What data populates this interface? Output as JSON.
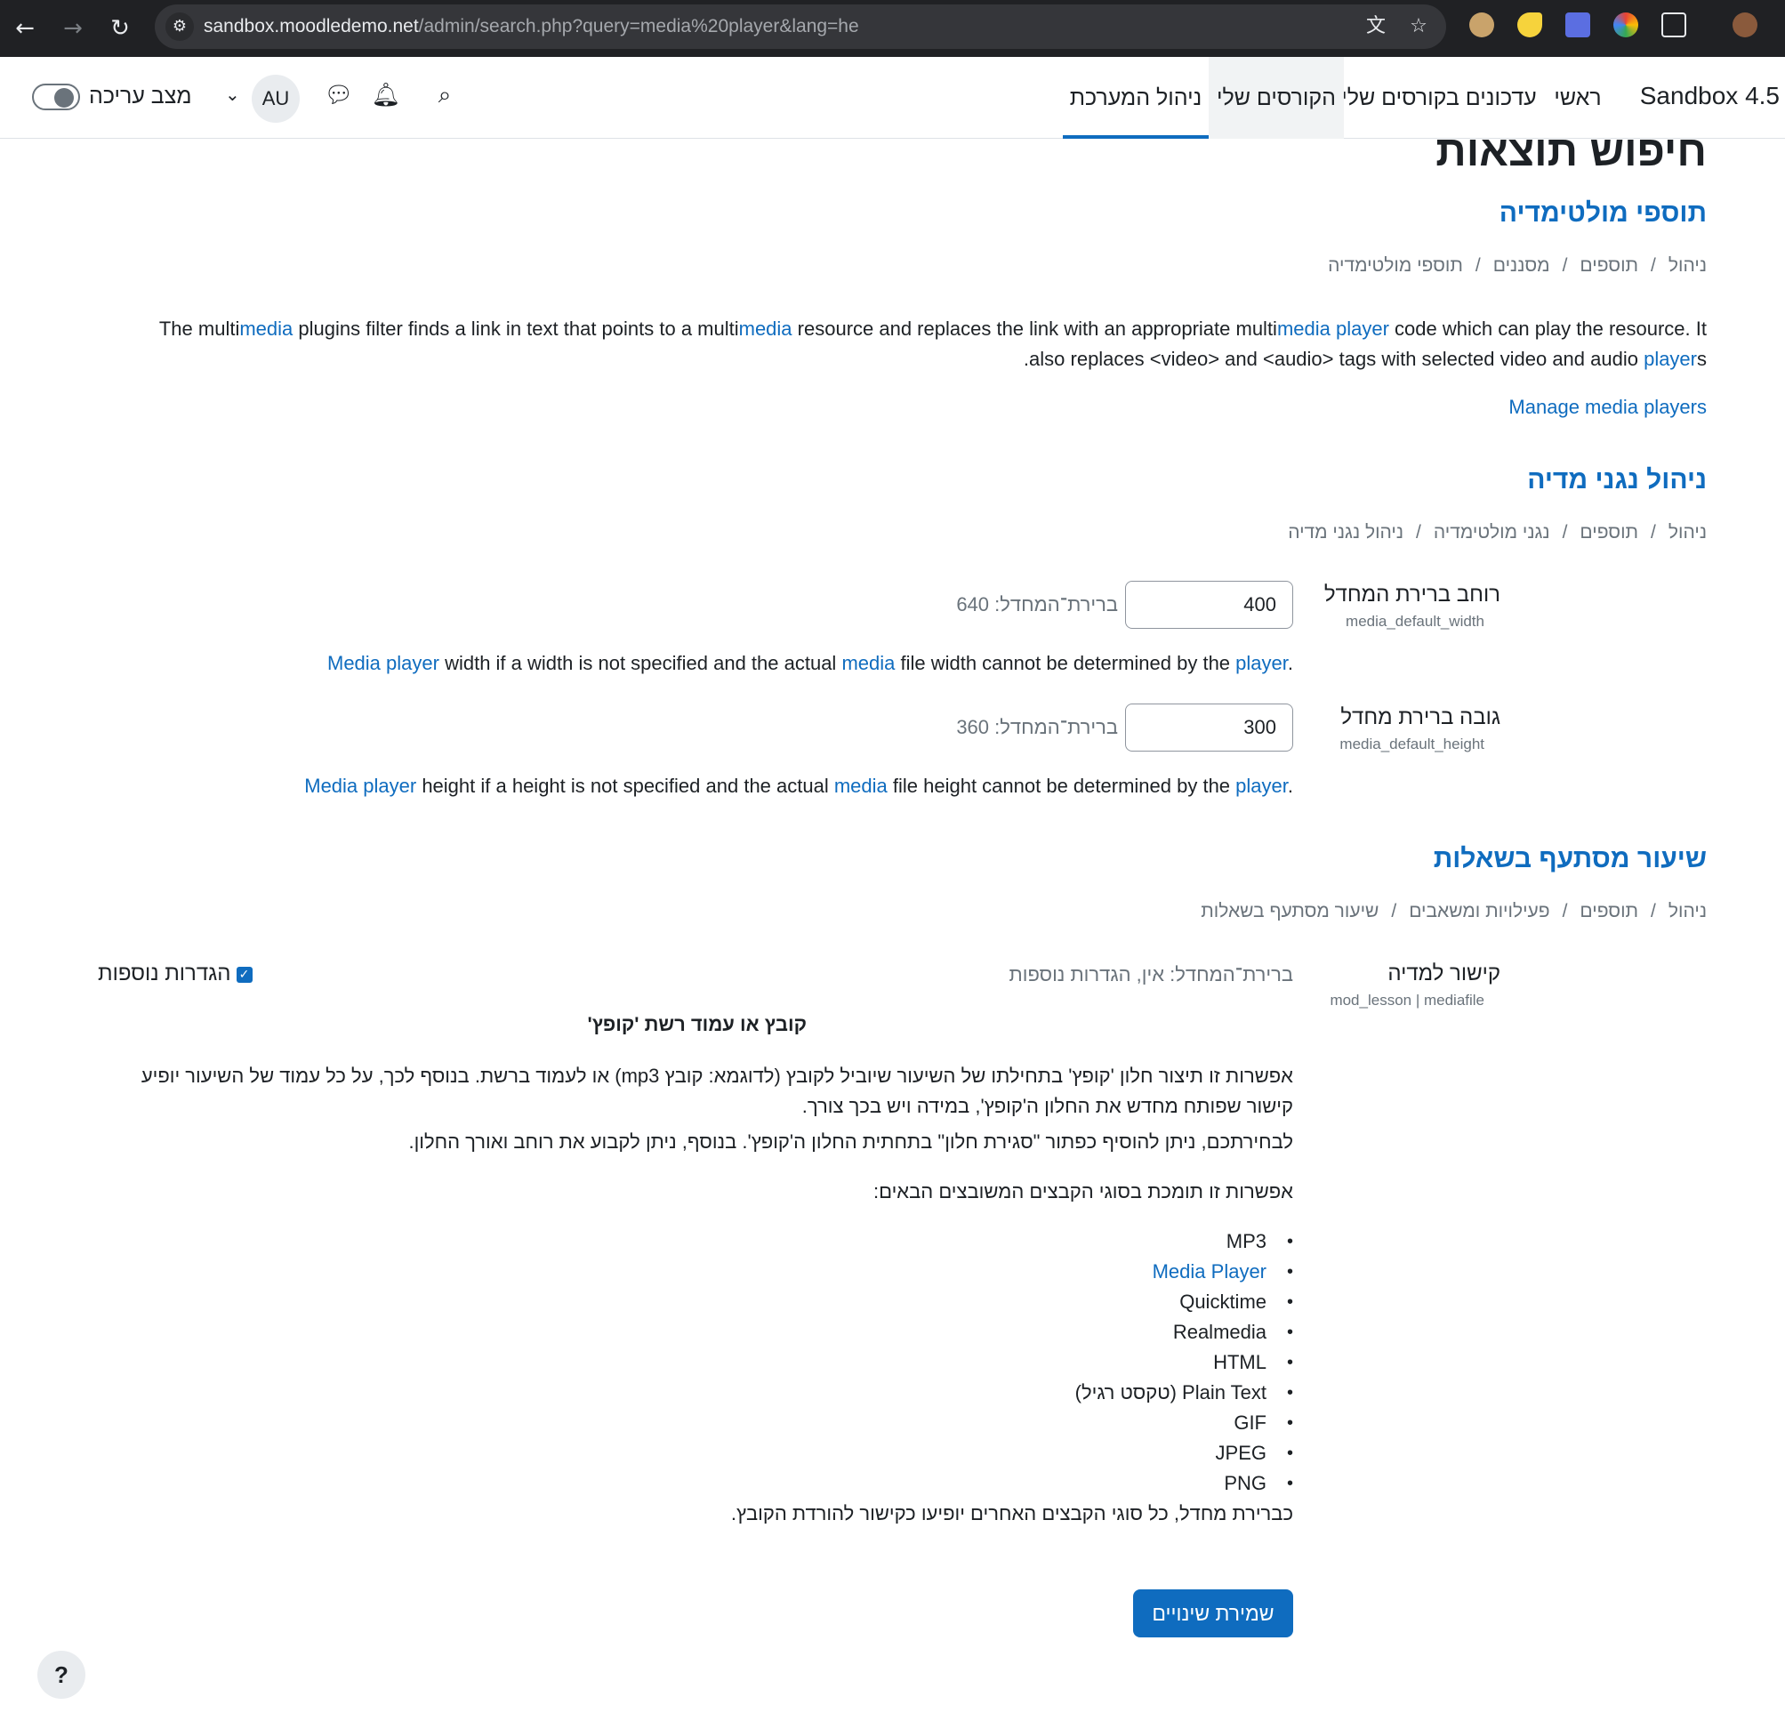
{
  "browser": {
    "url_host": "sandbox.moodledemo.net",
    "url_path": "/admin/search.php?query=media%20player&lang=he"
  },
  "nav": {
    "brand": "Sandbox 4.5",
    "home": "ראשי",
    "course_updates": "עדכונים בקורסים שלי",
    "my_courses": "הקורסים שלי",
    "site_admin": "ניהול המערכת",
    "avatar_initials": "AU",
    "edit_mode_label": "מצב עריכה"
  },
  "page": {
    "title": "חיפוש תוצאות"
  },
  "section1": {
    "title": "תוספי מולטימדיה",
    "breadcrumb": [
      "ניהול",
      "תוספים",
      "מסננים",
      "תוספי מולטימדיה"
    ],
    "desc": {
      "p1": "The multi",
      "h1": "media",
      "p2": " plugins filter finds a link in text that points to a multi",
      "h2": "media",
      "p3": " resource and replaces the link with an appropriate multi",
      "h3": "media player",
      "p4": " code which can play the resource. It",
      "line2_a": "also replaces <video> and <audio> tags with selected video and audio ",
      "line2_h": "player",
      "line2_b": "s",
      "line2_dot": "."
    },
    "manage_link": "Manage media players"
  },
  "section2": {
    "title": "ניהול נגני מדיה",
    "breadcrumb": [
      "ניהול",
      "תוספים",
      "נגני מולטימדיה",
      "ניהול נגני מדיה"
    ],
    "width": {
      "label": "רוחב ברירת המחדל",
      "key": "media_default_width",
      "value": "400",
      "default": "ברירת־המחדל: 640",
      "d1": "Media player",
      "d2": " width if a width is not specified and the actual ",
      "d3": "media",
      "d4": " file width cannot be determined by the ",
      "d5": "player",
      "d6": "."
    },
    "height": {
      "label": "גובה ברירת מחדל",
      "key": "media_default_height",
      "value": "300",
      "default": "ברירת־המחדל: 360",
      "d1": "Media player",
      "d2": " height if a height is not specified and the actual ",
      "d3": "media",
      "d4": " file height cannot be determined by the ",
      "d5": "player",
      "d6": "."
    }
  },
  "section3": {
    "title": "שיעור מסתעף בשאלות",
    "breadcrumb": [
      "ניהול",
      "תוספים",
      "פעילויות ומשאבים",
      "שיעור מסתעף בשאלות"
    ],
    "setting": {
      "label": "קישור למדיה",
      "key": "mod_lesson | mediafile",
      "default": "ברירת־המחדל: אין, הגדרות נוספות",
      "checkbox_label": "הגדרות נוספות",
      "subheading": "קובץ או עמוד רשת 'קופץ'",
      "para1": "אפשרות זו תיצור חלון 'קופץ' בתחילתו של השיעור שיוביל לקובץ (לדוגמא: קובץ mp3) או לעמוד ברשת. בנוסף לכך, על כל עמוד של השיעור יופיע קישור שפותח מחדש את החלון ה'קופץ', במידה ויש בכך צורך.",
      "para2": "לבחירתכם, ניתן להוסיף כפתור \"סגירת חלון\" בתחתית החלון ה'קופץ'. בנוסף, ניתן לקבוע את רוחב ואורך החלון.",
      "para3": "אפשרות זו תומכת בסוגי הקבצים המשובצים הבאים:",
      "filetypes": [
        "MP3",
        "Media Player",
        "Quicktime",
        "Realmedia",
        "HTML",
        "Plain Text (טקסט רגיל)",
        "GIF",
        "JPEG",
        "PNG"
      ],
      "para4": "כברירת מחדל, כל סוגי הקבצים האחרים יופיעו כקישור להורדת הקובץ."
    },
    "save_button": "שמירת שינויים"
  },
  "help": "?",
  "colors": {
    "accent": "#0f6cbf",
    "link": "#0f6cbf",
    "chrome_bg": "#202124"
  },
  "icons": [
    "back-icon",
    "forward-icon",
    "reload-icon",
    "site-info-icon",
    "translate-icon",
    "star-icon",
    "search-icon",
    "bell-icon",
    "chat-icon",
    "chevron-down-icon"
  ]
}
